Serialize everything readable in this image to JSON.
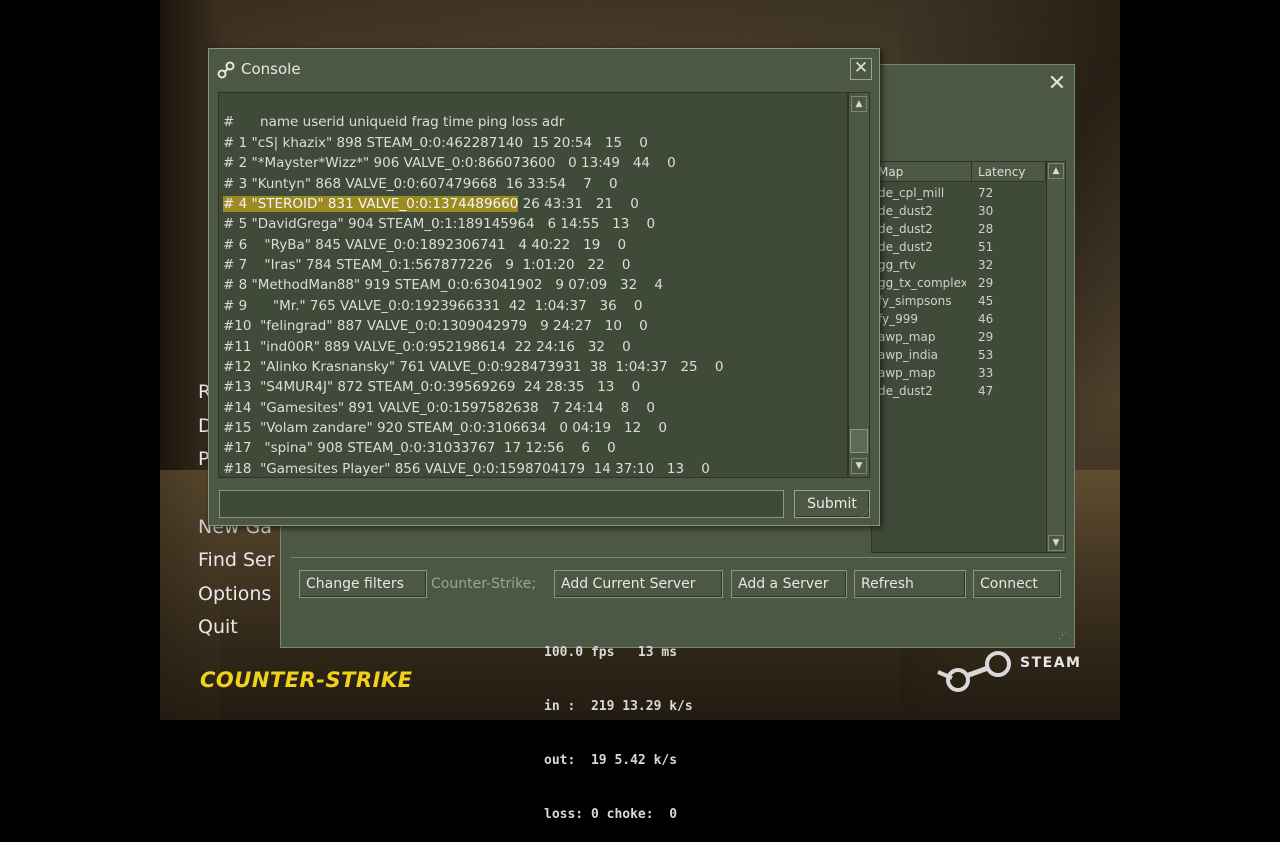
{
  "menu": {
    "items": [
      "R",
      "D",
      "P",
      "New Ga",
      "Find Ser",
      "Options",
      "Quit"
    ]
  },
  "logo": {
    "text": "COUNTER-STRIKE"
  },
  "steam": {
    "text": "STEAM"
  },
  "netgraph": {
    "lines": [
      "100.0 fps   13 ms",
      "in :  219 13.29 k/s",
      "out:  19 5.42 k/s",
      "loss: 0 choke:  0"
    ]
  },
  "browser": {
    "columns": {
      "map": "Map",
      "latency": "Latency"
    },
    "rows": [
      {
        "map": "de_cpl_mill",
        "latency": "72"
      },
      {
        "map": "de_dust2",
        "latency": "30"
      },
      {
        "map": "de_dust2",
        "latency": "28"
      },
      {
        "map": "de_dust2",
        "latency": "51"
      },
      {
        "map": "gg_rtv",
        "latency": "32"
      },
      {
        "map": "gg_tx_complex_...",
        "latency": "29"
      },
      {
        "map": "fy_simpsons",
        "latency": "45"
      },
      {
        "map": "fy_999",
        "latency": "46"
      },
      {
        "map": "awp_map",
        "latency": "29"
      },
      {
        "map": "awp_india",
        "latency": "53"
      },
      {
        "map": "awp_map",
        "latency": "33"
      },
      {
        "map": "de_dust2",
        "latency": "47"
      }
    ],
    "buttons": {
      "change_filters": "Change filters",
      "add_current": "Add Current Server",
      "add_server": "Add a Server",
      "refresh": "Refresh",
      "connect": "Connect"
    },
    "filter_label": "Counter-Strike;"
  },
  "console": {
    "title": "Console",
    "header": "#      name userid uniqueid frag time ping loss adr",
    "lines": [
      {
        "pre": "",
        "hl": "",
        "post": "# 1 \"cS| khazix\" 898 STEAM_0:0:462287140  15 20:54   15    0"
      },
      {
        "pre": "",
        "hl": "",
        "post": "# 2 \"*Mayster*Wizz*\" 906 VALVE_0:0:866073600   0 13:49   44    0"
      },
      {
        "pre": "",
        "hl": "",
        "post": "# 3 \"Kuntyn\" 868 VALVE_0:0:607479668  16 33:54    7    0"
      },
      {
        "pre": "",
        "hl": "# 4 \"STEROID\" 831 VALVE_0:0:1374489660",
        "post": " 26 43:31   21    0"
      },
      {
        "pre": "",
        "hl": "",
        "post": "# 5 \"DavidGrega\" 904 STEAM_0:1:189145964   6 14:55   13    0"
      },
      {
        "pre": "",
        "hl": "",
        "post": "# 6    \"RyBa\" 845 VALVE_0:0:1892306741   4 40:22   19    0"
      },
      {
        "pre": "",
        "hl": "",
        "post": "# 7    \"Iras\" 784 STEAM_0:1:567877226   9  1:01:20   22    0"
      },
      {
        "pre": "",
        "hl": "",
        "post": "# 8 \"MethodMan88\" 919 STEAM_0:0:63041902   9 07:09   32    4"
      },
      {
        "pre": "",
        "hl": "",
        "post": "# 9      \"Mr.\" 765 VALVE_0:0:1923966331  42  1:04:37   36    0"
      },
      {
        "pre": "",
        "hl": "",
        "post": "#10  \"felingrad\" 887 VALVE_0:0:1309042979   9 24:27   10    0"
      },
      {
        "pre": "",
        "hl": "",
        "post": "#11  \"ind00R\" 889 VALVE_0:0:952198614  22 24:16   32    0"
      },
      {
        "pre": "",
        "hl": "",
        "post": "#12  \"Alinko Krasnansky\" 761 VALVE_0:0:928473931  38  1:04:37   25    0"
      },
      {
        "pre": "",
        "hl": "",
        "post": "#13  \"S4MUR4J\" 872 STEAM_0:0:39569269  24 28:35   13    0"
      },
      {
        "pre": "",
        "hl": "",
        "post": "#14  \"Gamesites\" 891 VALVE_0:0:1597582638   7 24:14    8    0"
      },
      {
        "pre": "",
        "hl": "",
        "post": "#15  \"Volam zandare\" 920 STEAM_0:0:3106634   0 04:19   12    0"
      },
      {
        "pre": "",
        "hl": "",
        "post": "#17   \"spina\" 908 STEAM_0:0:31033767  17 12:56    6    0"
      },
      {
        "pre": "",
        "hl": "",
        "post": "#18  \"Gamesites Player\" 856 VALVE_0:0:1598704179  14 37:10   13    0"
      }
    ],
    "input_value": "",
    "submit_label": "Submit"
  },
  "colors": {
    "panel": "#4c5844",
    "panel_dark": "#3f4a38",
    "highlight": "#9c8a22",
    "logo": "#f1d21a"
  },
  "icons": {
    "steam_logo": "steam-logo-icon",
    "close": "close-icon",
    "scroll_up": "arrow-up-icon",
    "scroll_down": "arrow-down-icon"
  }
}
